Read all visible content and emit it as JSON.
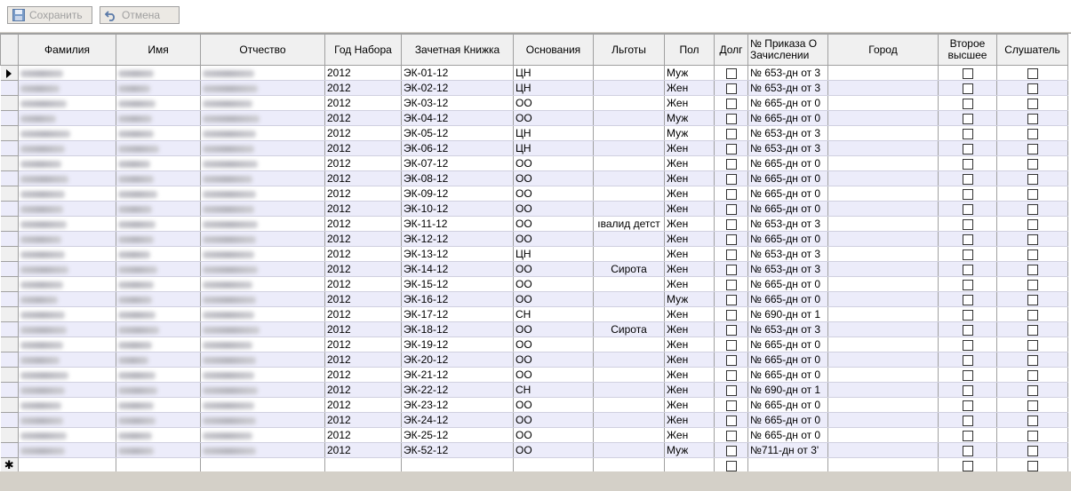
{
  "toolbar": {
    "save_label": "Сохранить",
    "cancel_label": "Отмена"
  },
  "columns": {
    "familia": "Фамилия",
    "imya": "Имя",
    "otchestvo": "Отчество",
    "god": "Год Набора",
    "zachetka": "Зачетная Книжка",
    "osnovaniya": "Основания",
    "lgoty": "Льготы",
    "pol": "Пол",
    "dolg": "Долг",
    "prikaz": "№ Приказа О Зачислении",
    "gorod": "Город",
    "vtoroe": "Второе высшее",
    "slushatel": "Слушатель"
  },
  "rows": [
    {
      "god": "2012",
      "zachetka": "ЭК-01-12",
      "osnovaniya": "ЦН",
      "lgoty": "",
      "pol": "Муж",
      "prikaz": "№ 653-дн от 3"
    },
    {
      "god": "2012",
      "zachetka": "ЭК-02-12",
      "osnovaniya": "ЦН",
      "lgoty": "",
      "pol": "Жен",
      "prikaz": "№ 653-дн от 3"
    },
    {
      "god": "2012",
      "zachetka": "ЭК-03-12",
      "osnovaniya": "ОО",
      "lgoty": "",
      "pol": "Жен",
      "prikaz": "№ 665-дн от 0"
    },
    {
      "god": "2012",
      "zachetka": "ЭК-04-12",
      "osnovaniya": "ОО",
      "lgoty": "",
      "pol": "Муж",
      "prikaz": "№ 665-дн от 0"
    },
    {
      "god": "2012",
      "zachetka": "ЭК-05-12",
      "osnovaniya": "ЦН",
      "lgoty": "",
      "pol": "Муж",
      "prikaz": "№ 653-дн от 3"
    },
    {
      "god": "2012",
      "zachetka": "ЭК-06-12",
      "osnovaniya": "ЦН",
      "lgoty": "",
      "pol": "Жен",
      "prikaz": "№ 653-дн от 3"
    },
    {
      "god": "2012",
      "zachetka": "ЭК-07-12",
      "osnovaniya": "ОО",
      "lgoty": "",
      "pol": "Жен",
      "prikaz": "№ 665-дн от 0"
    },
    {
      "god": "2012",
      "zachetka": "ЭК-08-12",
      "osnovaniya": "ОО",
      "lgoty": "",
      "pol": "Жен",
      "prikaz": "№ 665-дн от 0"
    },
    {
      "god": "2012",
      "zachetka": "ЭК-09-12",
      "osnovaniya": "ОО",
      "lgoty": "",
      "pol": "Жен",
      "prikaz": "№ 665-дн от 0"
    },
    {
      "god": "2012",
      "zachetka": "ЭК-10-12",
      "osnovaniya": "ОО",
      "lgoty": "",
      "pol": "Жен",
      "prikaz": "№ 665-дн от 0"
    },
    {
      "god": "2012",
      "zachetka": "ЭК-11-12",
      "osnovaniya": "ОО",
      "lgoty": "ıвалид детст",
      "pol": "Жен",
      "prikaz": "№ 653-дн от 3"
    },
    {
      "god": "2012",
      "zachetka": "ЭК-12-12",
      "osnovaniya": "ОО",
      "lgoty": "",
      "pol": "Жен",
      "prikaz": "№ 665-дн от 0"
    },
    {
      "god": "2012",
      "zachetka": "ЭК-13-12",
      "osnovaniya": "ЦН",
      "lgoty": "",
      "pol": "Жен",
      "prikaz": "№ 653-дн от 3"
    },
    {
      "god": "2012",
      "zachetka": "ЭК-14-12",
      "osnovaniya": "ОО",
      "lgoty": "Сирота",
      "pol": "Жен",
      "prikaz": "№ 653-дн от 3"
    },
    {
      "god": "2012",
      "zachetka": "ЭК-15-12",
      "osnovaniya": "ОО",
      "lgoty": "",
      "pol": "Жен",
      "prikaz": "№ 665-дн от 0"
    },
    {
      "god": "2012",
      "zachetka": "ЭК-16-12",
      "osnovaniya": "ОО",
      "lgoty": "",
      "pol": "Муж",
      "prikaz": "№ 665-дн от 0"
    },
    {
      "god": "2012",
      "zachetka": "ЭК-17-12",
      "osnovaniya": "СН",
      "lgoty": "",
      "pol": "Жен",
      "prikaz": "№ 690-дн от 1"
    },
    {
      "god": "2012",
      "zachetka": "ЭК-18-12",
      "osnovaniya": "ОО",
      "lgoty": "Сирота",
      "pol": "Жен",
      "prikaz": "№ 653-дн от 3"
    },
    {
      "god": "2012",
      "zachetka": "ЭК-19-12",
      "osnovaniya": "ОО",
      "lgoty": "",
      "pol": "Жен",
      "prikaz": "№ 665-дн от 0"
    },
    {
      "god": "2012",
      "zachetka": "ЭК-20-12",
      "osnovaniya": "ОО",
      "lgoty": "",
      "pol": "Жен",
      "prikaz": "№ 665-дн от 0"
    },
    {
      "god": "2012",
      "zachetka": "ЭК-21-12",
      "osnovaniya": "ОО",
      "lgoty": "",
      "pol": "Жен",
      "prikaz": "№ 665-дн от 0"
    },
    {
      "god": "2012",
      "zachetka": "ЭК-22-12",
      "osnovaniya": "СН",
      "lgoty": "",
      "pol": "Жен",
      "prikaz": "№ 690-дн от 1"
    },
    {
      "god": "2012",
      "zachetka": "ЭК-23-12",
      "osnovaniya": "ОО",
      "lgoty": "",
      "pol": "Жен",
      "prikaz": "№ 665-дн от 0"
    },
    {
      "god": "2012",
      "zachetka": "ЭК-24-12",
      "osnovaniya": "ОО",
      "lgoty": "",
      "pol": "Жен",
      "prikaz": "№ 665-дн от 0"
    },
    {
      "god": "2012",
      "zachetka": "ЭК-25-12",
      "osnovaniya": "ОО",
      "lgoty": "",
      "pol": "Жен",
      "prikaz": "№ 665-дн от 0"
    },
    {
      "god": "2012",
      "zachetka": "ЭК-52-12",
      "osnovaniya": "ОО",
      "lgoty": "",
      "pol": "Муж",
      "prikaz": "№711-дн от 3'"
    }
  ],
  "new_row_marker": "✱"
}
